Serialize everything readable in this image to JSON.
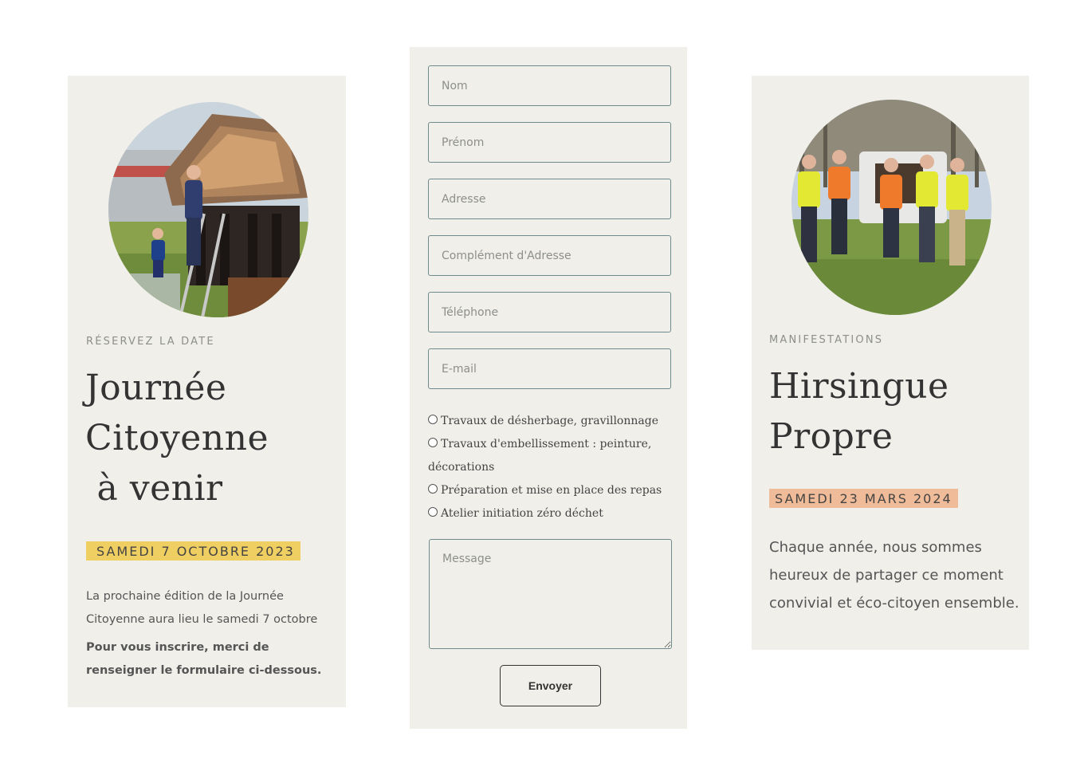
{
  "left_card": {
    "eyebrow": "RÉSERVEZ LA DATE",
    "title_lines": [
      "Journée",
      "Citoyenne",
      " à venir"
    ],
    "date": "SAMEDI 7 OCTOBRE 2023",
    "date_color": "#f0cf62",
    "text": "La prochaine édition de la Journée Citoyenne aura lieu le samedi 7 octobre",
    "text_bold": "Pour vous inscrire, merci de renseigner le formulaire ci-dessous."
  },
  "form": {
    "fields": [
      {
        "placeholder": "Nom"
      },
      {
        "placeholder": "Prénom"
      },
      {
        "placeholder": "Adresse"
      },
      {
        "placeholder": "Complément d'Adresse"
      },
      {
        "placeholder": "Téléphone"
      },
      {
        "placeholder": "E-mail"
      }
    ],
    "options": [
      "Travaux de désherbage, gravillonnage",
      "Travaux d'embellissement : peinture, décorations",
      "Préparation et mise en place des repas",
      "Atelier initiation zéro déchet"
    ],
    "message_placeholder": "Message",
    "submit_label": "Envoyer"
  },
  "right_card": {
    "eyebrow": "MANIFESTATIONS",
    "title_lines": [
      "Hirsingue",
      "Propre"
    ],
    "date": "SAMEDI 23 MARS 2024",
    "date_color": "#f0bb98",
    "text": "Chaque année, nous sommes heureux de partager ce moment convivial et éco-citoyen ensemble."
  },
  "colors": {
    "card_bg": "#f0efea",
    "field_border": "#6f8a8c",
    "heading": "#333333"
  }
}
